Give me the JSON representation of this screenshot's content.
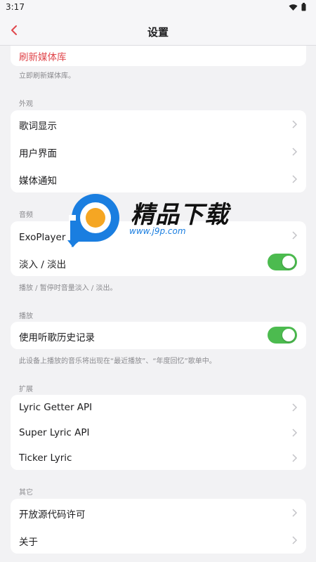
{
  "status_bar": {
    "time": "3:17"
  },
  "header": {
    "title": "设置"
  },
  "groups": {
    "media_library": {
      "refresh_label": "刷新媒体库",
      "footnote": "立即刷新媒体库。"
    },
    "appearance": {
      "header": "外观",
      "items": [
        "歌词显示",
        "用户界面",
        "媒体通知"
      ]
    },
    "audio": {
      "header": "音频",
      "exoplayer_label": "ExoPlayer 选",
      "fade_label": "淡入 / 淡出",
      "fade_enabled": true,
      "footnote": "播放 / 暂停时音量淡入 / 淡出。"
    },
    "playback": {
      "header": "播放",
      "history_label": "使用听歌历史记录",
      "history_enabled": true,
      "footnote": "此设备上播放的音乐将出现在“最近播放”、“年度回忆”歌单中。"
    },
    "extensions": {
      "header": "扩展",
      "items": [
        "Lyric Getter API",
        "Super Lyric API",
        "Ticker Lyric"
      ]
    },
    "other": {
      "header": "其它",
      "items": [
        "开放源代码许可",
        "关于"
      ]
    }
  },
  "watermark": {
    "title": "精品下载",
    "url": "www.j9p.com"
  },
  "colors": {
    "accent_red": "#e0474c",
    "toggle_on": "#4cbb4f"
  }
}
